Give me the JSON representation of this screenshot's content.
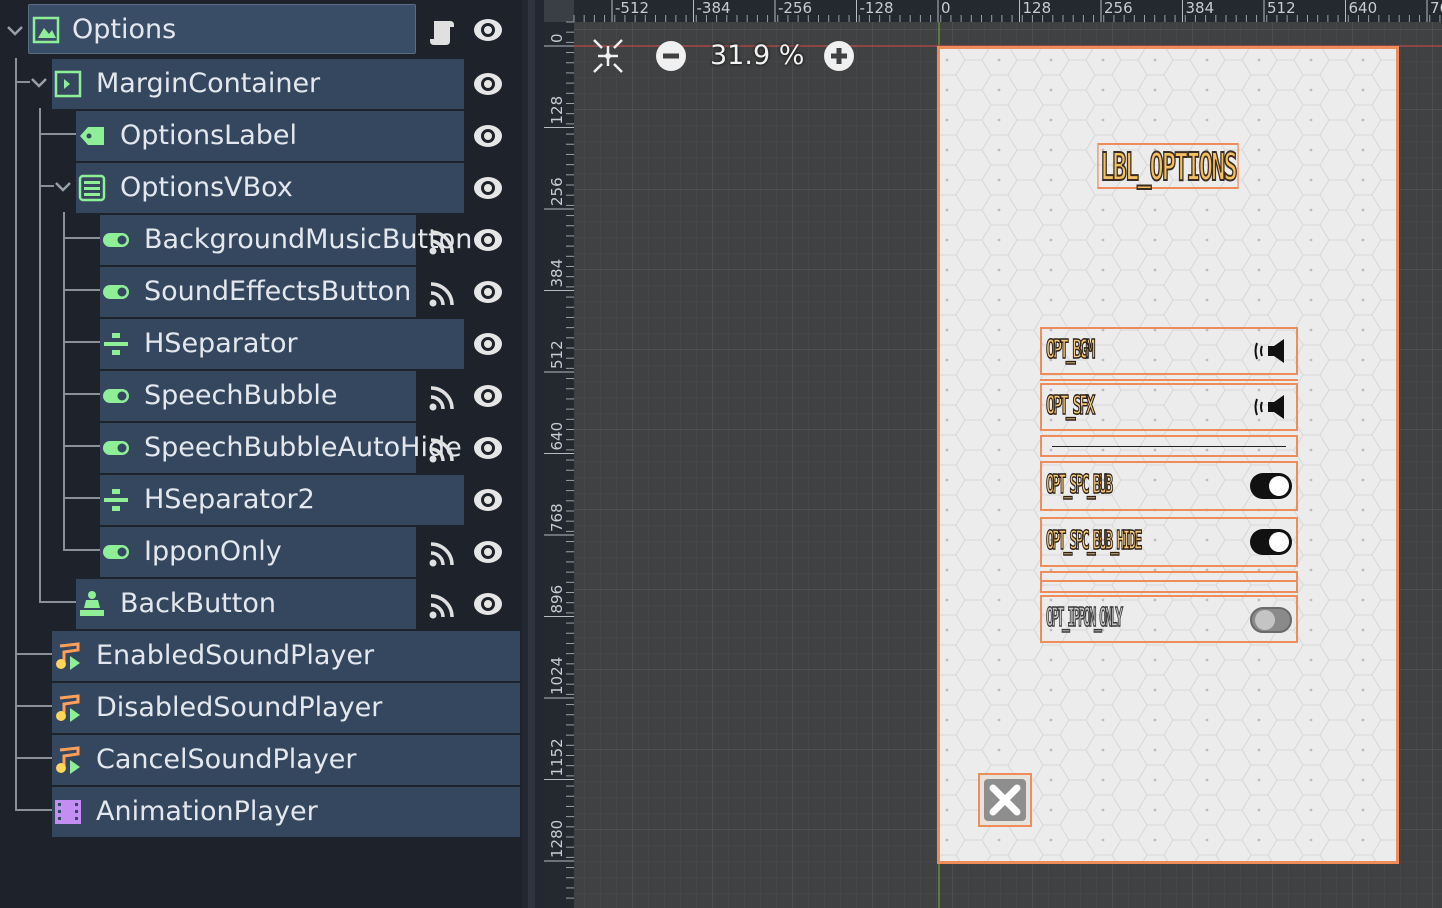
{
  "scene_tree": {
    "root": {
      "label": "Options",
      "icon": "control-root-icon"
    },
    "nodes": [
      {
        "label": "MarginContainer",
        "icon": "margin-container-icon"
      },
      {
        "label": "OptionsLabel",
        "icon": "label-icon"
      },
      {
        "label": "OptionsVBox",
        "icon": "vbox-container-icon"
      },
      {
        "label": "BackgroundMusicButton",
        "icon": "check-button-icon"
      },
      {
        "label": "SoundEffectsButton",
        "icon": "check-button-icon"
      },
      {
        "label": "HSeparator",
        "icon": "hseparator-icon"
      },
      {
        "label": "SpeechBubble",
        "icon": "check-button-icon"
      },
      {
        "label": "SpeechBubbleAutoHide",
        "icon": "check-button-icon"
      },
      {
        "label": "HSeparator2",
        "icon": "hseparator-icon"
      },
      {
        "label": "IpponOnly",
        "icon": "check-button-icon"
      },
      {
        "label": "BackButton",
        "icon": "texture-button-icon"
      },
      {
        "label": "EnabledSoundPlayer",
        "icon": "audio-stream-player-icon"
      },
      {
        "label": "DisabledSoundPlayer",
        "icon": "audio-stream-player-icon"
      },
      {
        "label": "CancelSoundPlayer",
        "icon": "audio-stream-player-icon"
      },
      {
        "label": "AnimationPlayer",
        "icon": "animation-player-icon"
      }
    ]
  },
  "viewport": {
    "zoom_label": "31.9 %",
    "ruler_h": [
      "-512",
      "-384",
      "-256",
      "-128",
      "0",
      "128",
      "256",
      "384",
      "512",
      "640",
      "76"
    ],
    "ruler_v": [
      "0",
      "128",
      "256",
      "384",
      "512",
      "640",
      "768",
      "896",
      "1024",
      "1152",
      "1280"
    ]
  },
  "game_ui": {
    "title": "LBL_OPTIONS",
    "options": [
      {
        "label": "OPT_BGM",
        "control": "speaker-icon"
      },
      {
        "label": "OPT_SFX",
        "control": "speaker-icon"
      },
      {
        "label": "OPT_SPC_BUB",
        "control": "toggle-on"
      },
      {
        "label": "OPT_SPC_BUB_HIDE",
        "control": "toggle-on"
      },
      {
        "label": "OPT_IPPON_ONLY",
        "control": "toggle-disabled"
      }
    ]
  },
  "colors": {
    "tree_node_bg": "#35475e",
    "tree_icon_green": "#8eef97",
    "selection_orange": "#f08c5a",
    "viewport_bg": "#404142",
    "label_text": "#f7c97a"
  }
}
